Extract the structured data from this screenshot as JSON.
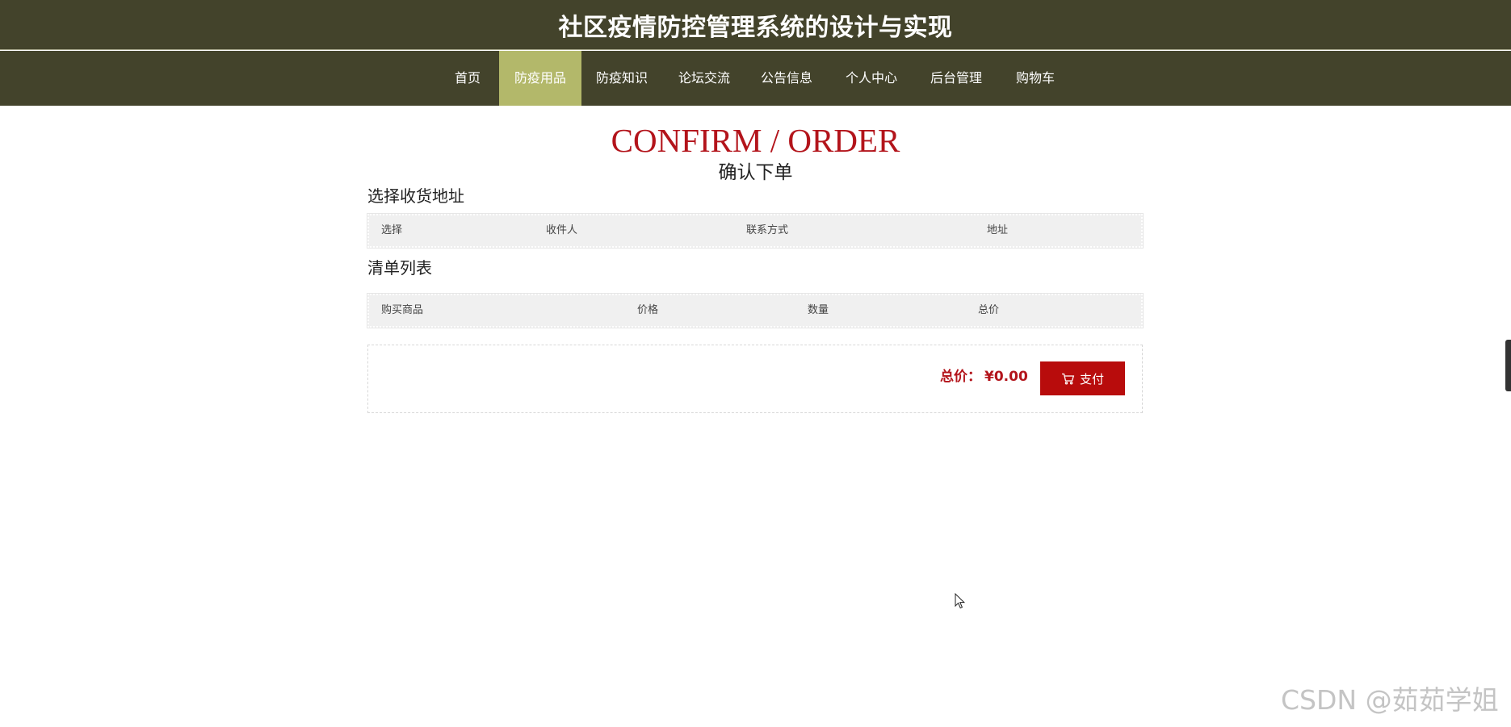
{
  "header": {
    "title": "社区疫情防控管理系统的设计与实现"
  },
  "nav": {
    "items": [
      {
        "label": "首页"
      },
      {
        "label": "防疫用品"
      },
      {
        "label": "防疫知识"
      },
      {
        "label": "论坛交流"
      },
      {
        "label": "公告信息"
      },
      {
        "label": "个人中心"
      },
      {
        "label": "后台管理"
      },
      {
        "label": "购物车"
      }
    ],
    "active_label": "防疫用品",
    "active_color": "#b3b86a"
  },
  "page": {
    "title_en": "CONFIRM / ORDER",
    "title_cn": "确认下单"
  },
  "address_section": {
    "title": "选择收货地址",
    "columns": [
      "选择",
      "收件人",
      "联系方式",
      "地址"
    ]
  },
  "order_section": {
    "title": "清单列表",
    "columns": [
      "购买商品",
      "价格",
      "数量",
      "总价"
    ]
  },
  "summary": {
    "total_label": "总价：",
    "total_value": "¥0.00",
    "pay_label": "支付"
  },
  "watermark": "CSDN @茹茹学姐",
  "colors": {
    "header_bg": "#43432b",
    "accent_red": "#b3141b",
    "button_red": "#b80c0c"
  },
  "icons": {
    "pay": "cart-icon",
    "pointer": "cursor-arrow-icon"
  }
}
